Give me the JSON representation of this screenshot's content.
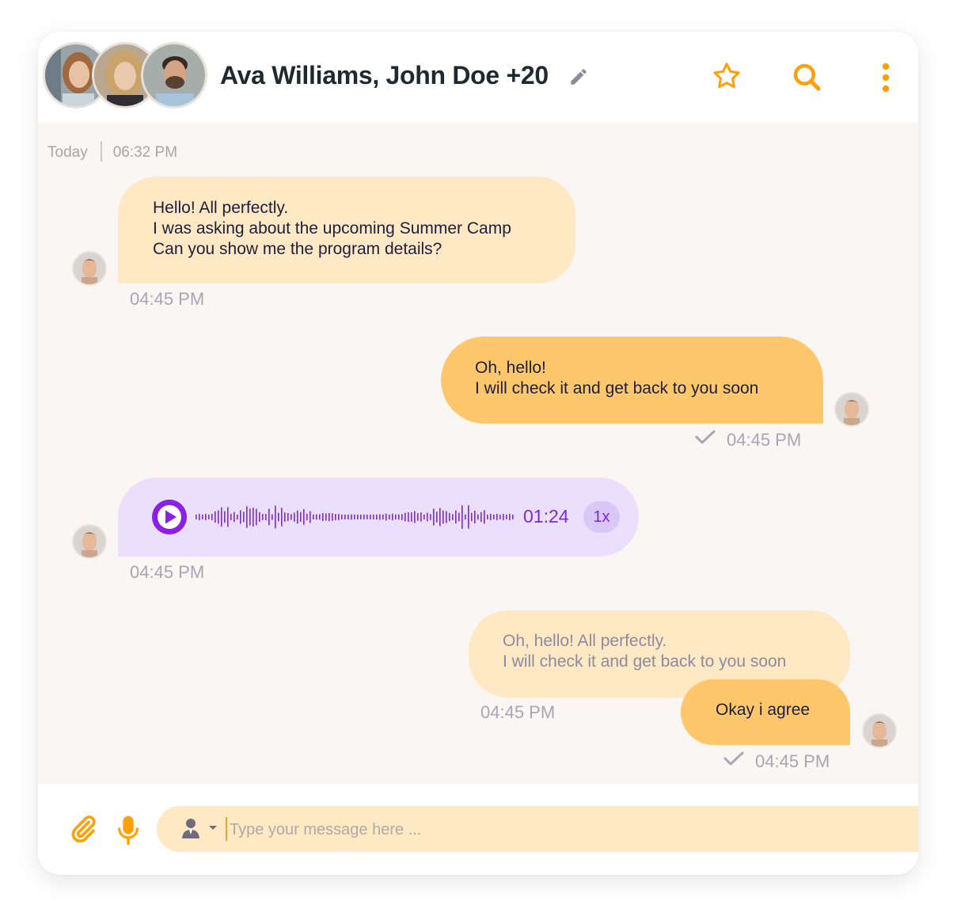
{
  "header": {
    "title": "Ava Williams, John Doe +20",
    "icons": [
      "pencil-icon",
      "star-icon",
      "search-icon",
      "more-vertical-icon"
    ],
    "accent": "#ff9f0a"
  },
  "date_row": {
    "day": "Today",
    "time": "06:32 PM"
  },
  "messages": [
    {
      "from": "them",
      "text": "Hello! All perfectly.\nI was asking about the upcoming Summer Camp\nCan you show me the program details?",
      "time": "04:45 PM"
    },
    {
      "from": "me",
      "text": "Oh, hello!\nI will check it and get back to you soon",
      "time": "04:45 PM",
      "read": true
    },
    {
      "from": "them",
      "type": "audio",
      "duration": "01:24",
      "speed": "1x",
      "time": "04:45 PM"
    },
    {
      "from": "them",
      "text": "Oh, hello! All perfectly.\nI will check it and get back to you soon",
      "time": "04:45 PM"
    },
    {
      "from": "me",
      "text": "Okay i agree",
      "time": "04:45 PM",
      "read": true
    }
  ],
  "composer": {
    "placeholder": "Type your message here ...",
    "icons": [
      "paperclip-icon",
      "microphone-icon",
      "user-icon",
      "caret-down-icon"
    ]
  },
  "colors": {
    "incoming_bubble": "#ffe9c4",
    "outgoing_bubble": "#ffc76b",
    "audio_bubble": "#eadffd",
    "audio_accent": "#8a1fe5",
    "chat_background": "#f9f6f3"
  }
}
